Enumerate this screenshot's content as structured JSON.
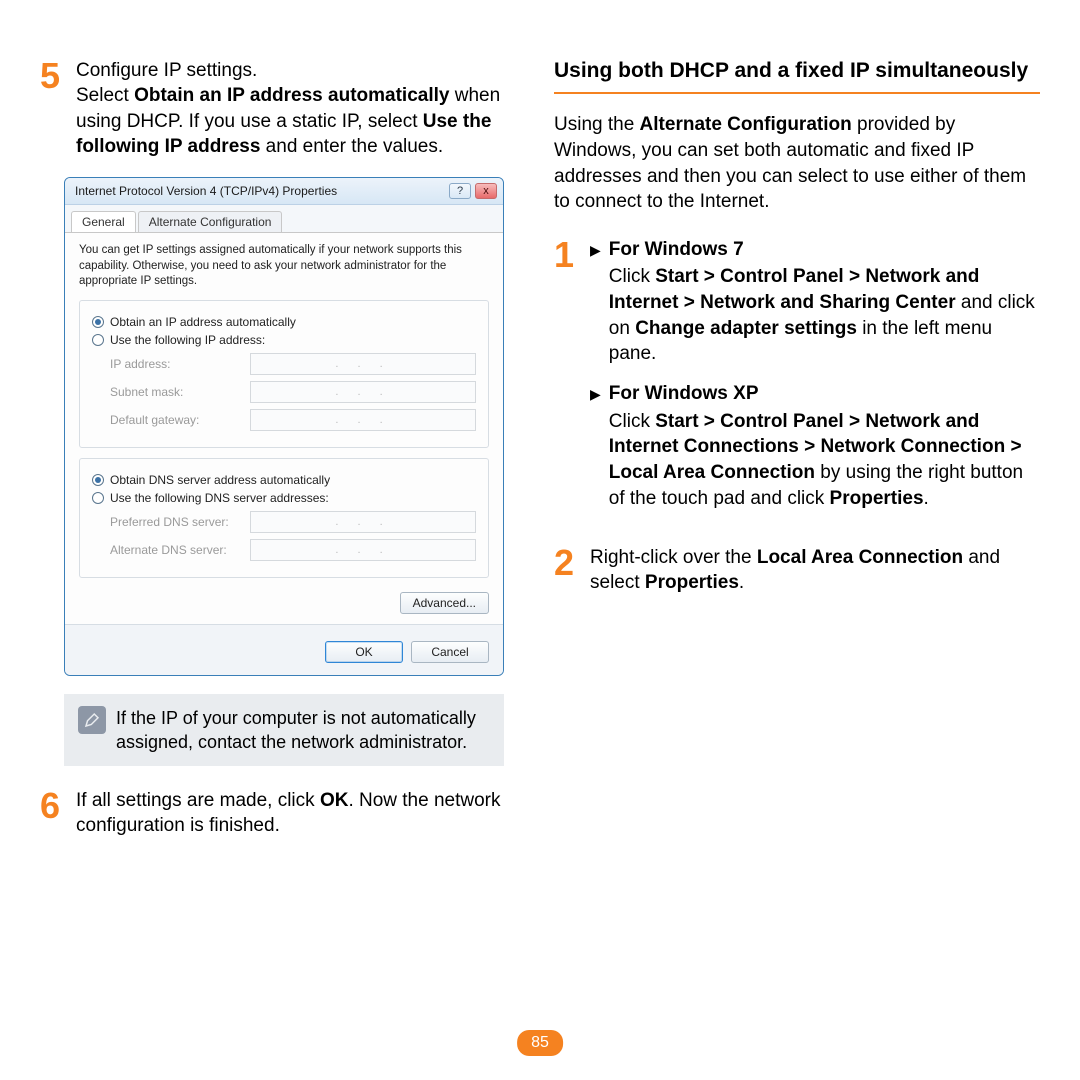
{
  "left": {
    "step5": {
      "num": "5",
      "intro": "Configure IP settings.",
      "body_pre": "Select ",
      "b1": "Obtain an IP address automatically",
      "mid1": " when using DHCP. If you use a static IP, select ",
      "b2": "Use the following IP address",
      "mid2": " and enter the values."
    },
    "dialog": {
      "title": "Internet Protocol Version 4 (TCP/IPv4) Properties",
      "help": "?",
      "close": "x",
      "tab1": "General",
      "tab2": "Alternate Configuration",
      "intro": "You can get IP settings assigned automatically if your network supports this capability. Otherwise, you need to ask your network administrator for the appropriate IP settings.",
      "r1": "Obtain an IP address automatically",
      "r2": "Use the following IP address:",
      "f_ip": "IP address:",
      "f_mask": "Subnet mask:",
      "f_gw": "Default gateway:",
      "r3": "Obtain DNS server address automatically",
      "r4": "Use the following DNS server addresses:",
      "f_pdns": "Preferred DNS server:",
      "f_adns": "Alternate DNS server:",
      "advanced": "Advanced...",
      "ok": "OK",
      "cancel": "Cancel"
    },
    "note": "If the IP of your computer is not automatically assigned, contact the network administrator.",
    "step6": {
      "num": "6",
      "pre": "If all settings are made, click ",
      "b": "OK",
      "post": ". Now the network configuration is finished."
    }
  },
  "right": {
    "heading": "Using both DHCP and a fixed IP simultaneously",
    "para_pre": "Using the ",
    "para_b": "Alternate Configuration",
    "para_post": " provided by Windows, you can set both automatic and fixed IP addresses and then you can select to use either of them to connect to the Internet.",
    "step1": {
      "num": "1",
      "win7_title": "For Windows 7",
      "win7_pre": "Click ",
      "win7_b1": "Start > Control Panel > Network and Internet > Network and Sharing Center",
      "win7_mid": " and click on ",
      "win7_b2": "Change adapter settings",
      "win7_post": " in the left menu pane.",
      "xp_title": "For Windows XP",
      "xp_pre": "Click ",
      "xp_b1": "Start > Control Panel > Network and Internet Connections > Network Connection > Local Area Connection",
      "xp_mid": " by using the right button of the touch pad and click ",
      "xp_b2": "Properties",
      "xp_post": "."
    },
    "step2": {
      "num": "2",
      "pre": "Right-click over the ",
      "b1": "Local Area Connection",
      "mid": " and select ",
      "b2": "Properties",
      "post": "."
    }
  },
  "page_number": "85"
}
